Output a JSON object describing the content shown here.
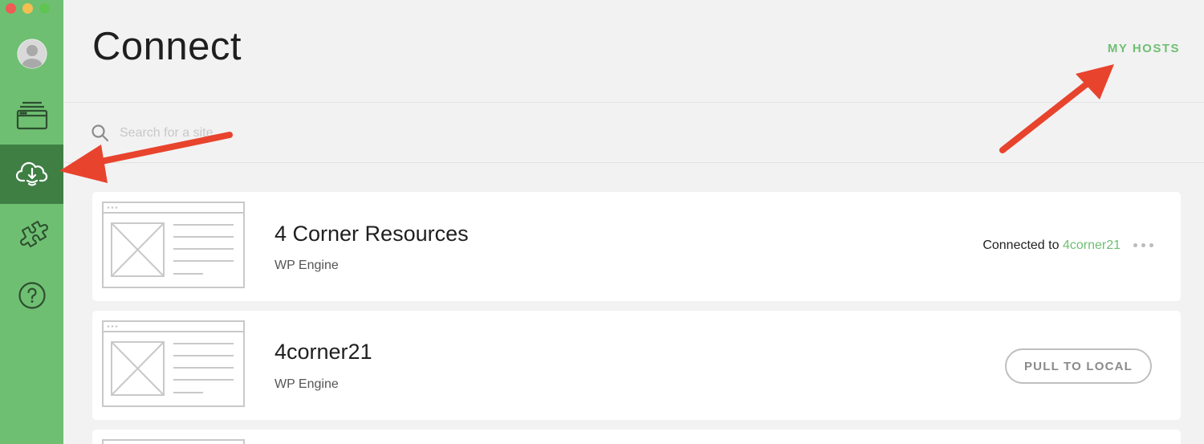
{
  "window": {
    "controls": [
      "close",
      "minimize",
      "maximize"
    ]
  },
  "sidebar": {
    "accent": "#6fbf73",
    "active_color": "#3f7f44",
    "items": [
      {
        "icon": "user-avatar-icon"
      },
      {
        "icon": "sites-icon"
      },
      {
        "icon": "connect-cloud-icon",
        "active": true
      },
      {
        "icon": "addons-puzzle-icon"
      },
      {
        "icon": "help-icon"
      }
    ]
  },
  "header": {
    "title": "Connect",
    "my_hosts_label": "MY HOSTS"
  },
  "search": {
    "placeholder": "Search for a site..."
  },
  "sites": [
    {
      "name": "4 Corner Resources",
      "host": "WP Engine",
      "status_prefix": "Connected to",
      "status_link": "4corner21"
    },
    {
      "name": "4corner21",
      "host": "WP Engine",
      "action_label": "PULL TO LOCAL"
    }
  ],
  "annotations": {
    "arrow_color": "#e8432d"
  }
}
